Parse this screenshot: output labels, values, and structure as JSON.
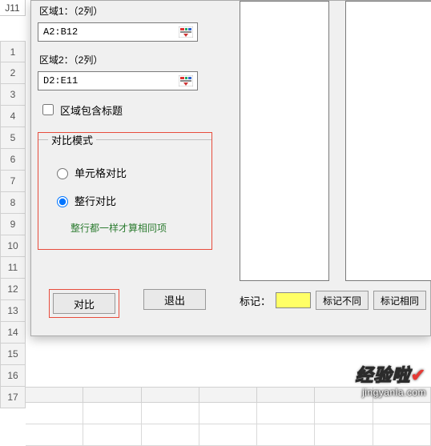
{
  "cell_reference": "J11",
  "region1": {
    "label": "区域1：（2列）",
    "value": "A2:B12"
  },
  "region2": {
    "label": "区域2：（2列）",
    "value": "D2:E11"
  },
  "include_title_checkbox": {
    "label": "区域包含标题",
    "checked": false
  },
  "compare_mode": {
    "legend": "对比模式",
    "options": {
      "cell": {
        "label": "单元格对比",
        "selected": false
      },
      "row": {
        "label": "整行对比",
        "selected": true,
        "hint": "整行都一样才算相同项"
      }
    }
  },
  "buttons": {
    "compare": "对比",
    "exit": "退出",
    "mark_diff": "标记不同",
    "mark_same": "标记相同"
  },
  "mark_label": "标记：",
  "mark_color": "#ffff66",
  "row_headers": [
    1,
    2,
    3,
    4,
    5,
    6,
    7,
    8,
    9,
    10,
    11,
    12,
    13,
    14,
    15,
    16,
    17
  ],
  "watermark": {
    "brand": "经验啦",
    "url": "jingyanla.com"
  }
}
